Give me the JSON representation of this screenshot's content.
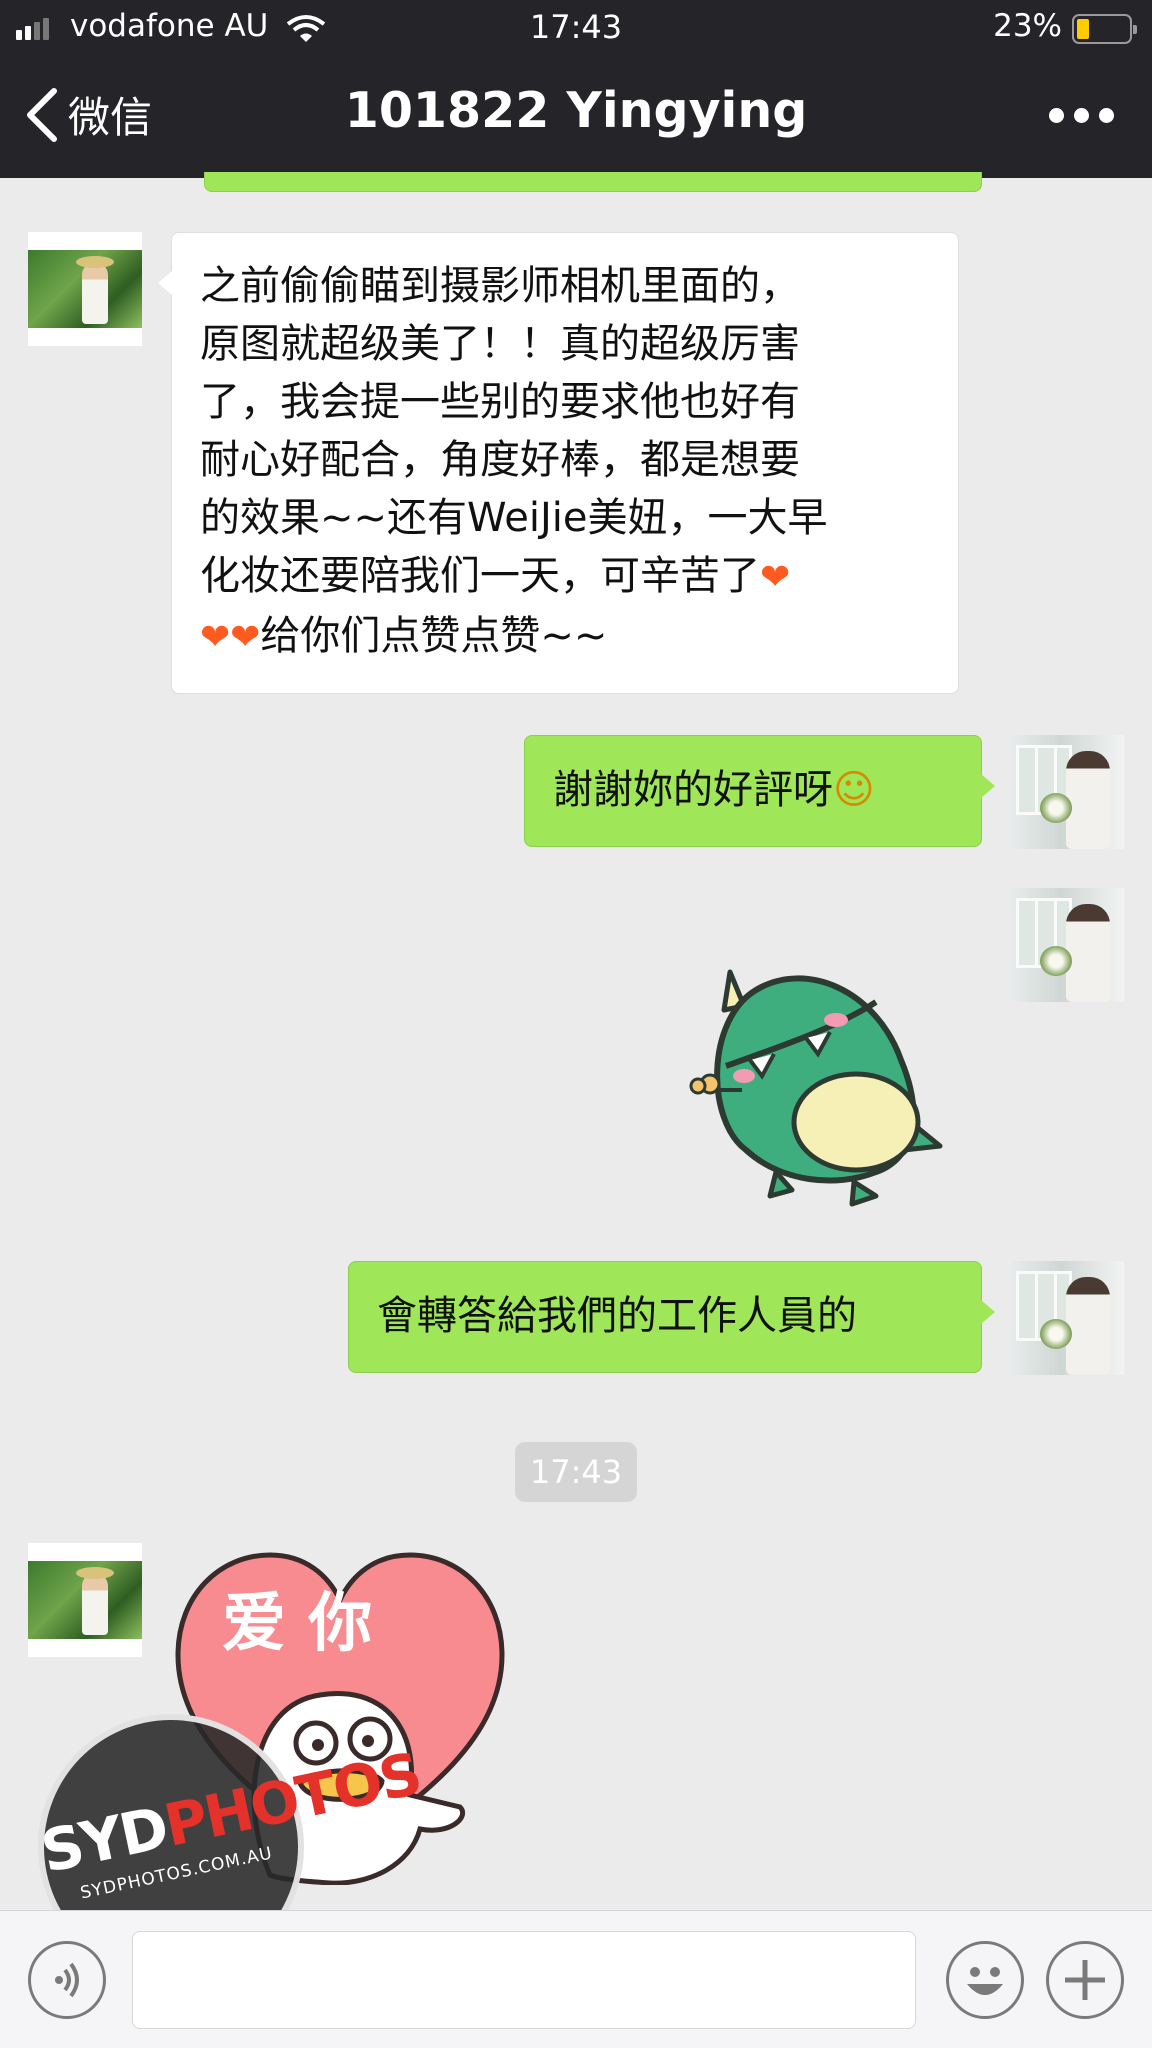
{
  "status_bar": {
    "carrier": "vodafone AU",
    "time": "17:43",
    "battery_percent": "23%",
    "battery_level": 0.23,
    "signal_bars": 2
  },
  "nav": {
    "back_label": "微信",
    "title": "101822 Yingying",
    "more_icon": "more-dots-icon"
  },
  "messages": [
    {
      "sender": "contact",
      "type": "text",
      "lines": [
        "之前偷偷瞄到摄影师相机里面的，",
        "原图就超级美了！！真的超级厉害",
        "了，我会提一些别的要求他也好有",
        "耐心好配合，角度好棒，都是想要",
        "的效果~~还有WeiJie美妞，一大早",
        "化妆还要陪我们一天，可辛苦了",
        "给你们点赞点赞~~"
      ],
      "emoji": "❤"
    },
    {
      "sender": "me",
      "type": "text",
      "text": "謝謝妳的好評呀",
      "emoji": "☺"
    },
    {
      "sender": "me",
      "type": "sticker",
      "sticker": "green-dinosaur-sticker"
    },
    {
      "sender": "me",
      "type": "text",
      "text": "會轉答給我們的工作人員的"
    },
    {
      "sender": "contact",
      "type": "sticker",
      "sticker": "heart-duck-sticker",
      "sticker_text": "爱 你"
    }
  ],
  "timestamp": "17:43",
  "watermark": {
    "brand_a": "SYD",
    "brand_b": "PHOTOS",
    "url": "SYDPHOTOS.COM.AU"
  },
  "input_bar": {
    "value": "",
    "voice_icon": "voice-icon",
    "emoji_icon": "emoji-icon",
    "plus_icon": "plus-icon"
  },
  "colors": {
    "nav_bg": "#242429",
    "chat_bg": "#ebebeb",
    "my_bubble": "#9fe658",
    "their_bubble": "#ffffff",
    "battery": "#ffcc00"
  }
}
